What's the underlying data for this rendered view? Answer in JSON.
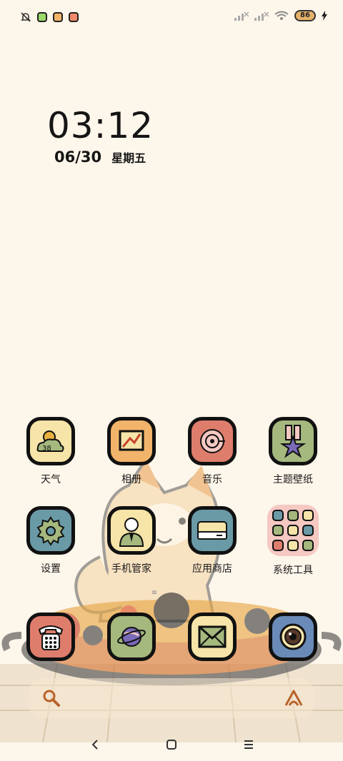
{
  "status_bar": {
    "battery_level": "86",
    "icons": [
      "bell-muted-icon",
      "notification-app-icon",
      "weibo-icon",
      "message-app-icon",
      "signal-icon",
      "signal-icon",
      "wifi-icon",
      "battery-icon",
      "charging-icon"
    ]
  },
  "clock_widget": {
    "time": "03:12",
    "date": "06/30",
    "weekday": "星期五"
  },
  "weather_icon_text": "38",
  "apps_row1": [
    {
      "label": "天气",
      "icon": "weather-icon",
      "bg": "#f6e4a8"
    },
    {
      "label": "相册",
      "icon": "gallery-icon",
      "bg": "#f2b46a"
    },
    {
      "label": "音乐",
      "icon": "music-icon",
      "bg": "#df7d6c"
    },
    {
      "label": "主题壁纸",
      "icon": "themes-icon",
      "bg": "#a5b87e"
    }
  ],
  "apps_row2": [
    {
      "label": "设置",
      "icon": "settings-icon",
      "bg": "#6a9aa6"
    },
    {
      "label": "手机管家",
      "icon": "security-icon",
      "bg": "#f6e4a8"
    },
    {
      "label": "应用商店",
      "icon": "app-store-icon",
      "bg": "#6a9aa6"
    },
    {
      "label": "系统工具",
      "icon": "folder-icon",
      "bg": "#f5c8c2"
    }
  ],
  "dock": [
    {
      "icon": "phone-icon",
      "bg": "#df7d6c"
    },
    {
      "icon": "browser-icon",
      "bg": "#a5b87e"
    },
    {
      "icon": "messages-icon",
      "bg": "#f6e4a8"
    },
    {
      "icon": "camera-icon",
      "bg": "#6a8ab8"
    }
  ],
  "page_indicator": "≡",
  "colors": {
    "background": "#fdf6ea",
    "icon_border": "#111111",
    "accent_orange": "#b8622a"
  }
}
